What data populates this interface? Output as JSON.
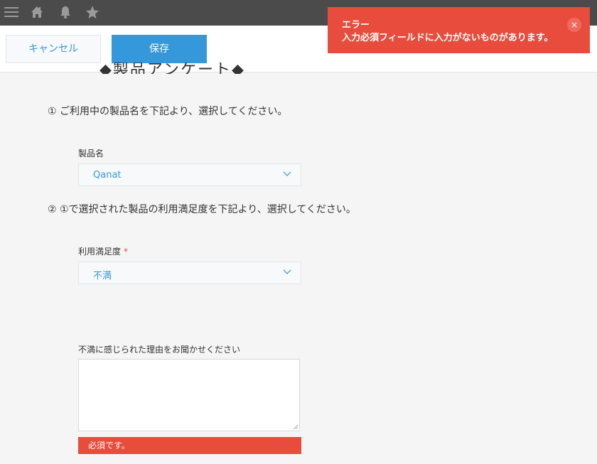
{
  "header": {
    "menu_icon": "hamburger-icon",
    "home_icon": "home-icon",
    "bell_icon": "bell-icon",
    "star_icon": "star-icon"
  },
  "actions": {
    "cancel_label": "キャンセル",
    "save_label": "保存"
  },
  "form": {
    "heading_partial": "◆製品アンケート◆",
    "q1_text": "① ご利用中の製品名を下記より、選択してください。",
    "product_label": "製品名",
    "product_value": "Qanat",
    "q2_text": "② ①で選択された製品の利用満足度を下記より、選択してください。",
    "satisfaction_label": "利用満足度",
    "required_mark": "*",
    "satisfaction_value": "不満",
    "reason_label": "不満に感じられた理由をお聞かせください",
    "reason_value": "",
    "reason_error": "必須です。"
  },
  "toast": {
    "title": "エラー",
    "message": "入力必須フィールドに入力がないものがあります。",
    "close_label": "×"
  },
  "colors": {
    "accent": "#3498db",
    "error": "#e74c3c",
    "topbar": "#4b4b4b"
  }
}
